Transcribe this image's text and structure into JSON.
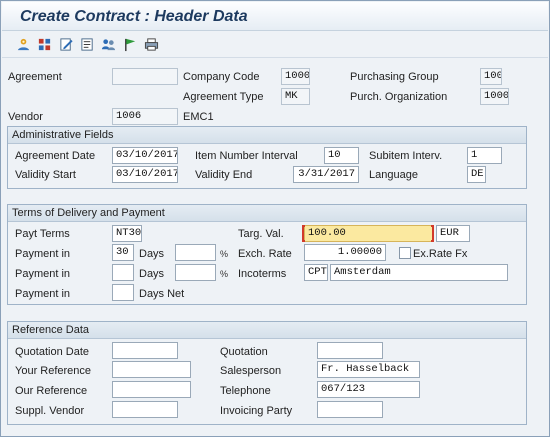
{
  "title": "Create Contract : Header Data",
  "toolbar": {
    "icons": [
      "partners-icon",
      "org-data-icon",
      "texts-icon",
      "conditions-icon",
      "address-icon",
      "flag-icon",
      "print-icon"
    ]
  },
  "header": {
    "agreement_label": "Agreement",
    "agreement_value": "",
    "company_code_label": "Company Code",
    "company_code_value": "1000",
    "purchasing_group_label": "Purchasing Group",
    "purchasing_group_value": "100",
    "agreement_type_label": "Agreement Type",
    "agreement_type_value": "MK",
    "purch_org_label": "Purch. Organization",
    "purch_org_value": "1000",
    "vendor_label": "Vendor",
    "vendor_value": "1006",
    "vendor_name": "EMC1"
  },
  "admin": {
    "title": "Administrative Fields",
    "agreement_date_label": "Agreement Date",
    "agreement_date_value": "03/10/2017",
    "item_interval_label": "Item Number Interval",
    "item_interval_value": "10",
    "subitem_interval_label": "Subitem Interv.",
    "subitem_interval_value": "1",
    "validity_start_label": "Validity Start",
    "validity_start_value": "03/10/2017",
    "validity_end_label": "Validity End",
    "validity_end_value": "3/31/2017",
    "language_label": "Language",
    "language_value": "DE"
  },
  "delivery": {
    "title": "Terms of Delivery and Payment",
    "payt_terms_label": "Payt Terms",
    "payt_terms_value": "NT30",
    "targ_val_label": "Targ. Val.",
    "targ_val_value": "100.00",
    "currency_value": "EUR",
    "payment_in_1_label": "Payment in",
    "payment_in_1_days": "30",
    "days_1_label": "Days",
    "percent_1_value": "",
    "percent_sign": "%",
    "exch_rate_label": "Exch. Rate",
    "exch_rate_value": "1.00000",
    "exch_rate_fx_label": "Ex.Rate Fx",
    "payment_in_2_label": "Payment in",
    "payment_in_2_days": "",
    "days_2_label": "Days",
    "percent_2_value": "",
    "incoterms_label": "Incoterms",
    "incoterms_code": "CPT",
    "incoterms_place": "Amsterdam",
    "payment_in_3_label": "Payment in",
    "payment_in_3_days": "",
    "days_net_label": "Days Net"
  },
  "reference": {
    "title": "Reference Data",
    "quotation_date_label": "Quotation Date",
    "quotation_date_value": "",
    "quotation_label": "Quotation",
    "quotation_value": "",
    "your_reference_label": "Your Reference",
    "your_reference_value": "",
    "salesperson_label": "Salesperson",
    "salesperson_value": "Fr. Hasselback",
    "our_reference_label": "Our Reference",
    "our_reference_value": "",
    "telephone_label": "Telephone",
    "telephone_value": "067/123",
    "suppl_vendor_label": "Suppl. Vendor",
    "suppl_vendor_value": "",
    "invoicing_party_label": "Invoicing Party",
    "invoicing_party_value": ""
  }
}
